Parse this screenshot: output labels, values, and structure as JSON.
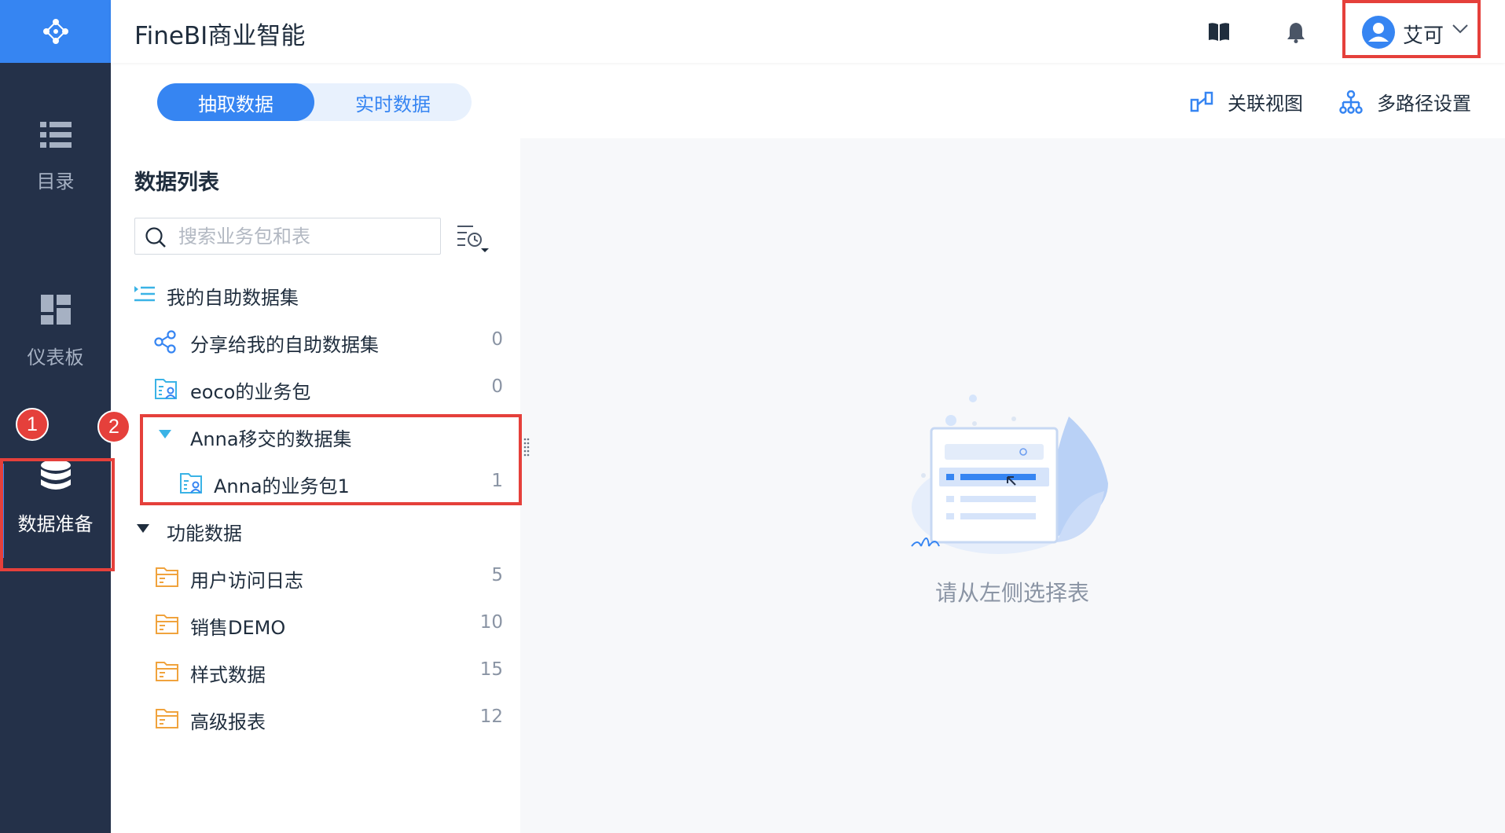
{
  "app": {
    "title": "FineBI商业智能"
  },
  "nav": {
    "items": [
      {
        "label": "目录",
        "icon": "list-icon"
      },
      {
        "label": "仪表板",
        "icon": "dashboard-icon"
      },
      {
        "label": "数据准备",
        "icon": "database-icon",
        "active": true
      }
    ]
  },
  "header": {
    "help_icon": "book-icon",
    "notify_icon": "bell-icon",
    "user": {
      "name": "艾可",
      "icon": "user-avatar-icon"
    }
  },
  "tabs": {
    "extract": "抽取数据",
    "realtime": "实时数据",
    "selected": "抽取数据"
  },
  "toolbar": {
    "relation_view": "关联视图",
    "multipath": "多路径设置"
  },
  "panel": {
    "title": "数据列表",
    "search_placeholder": "搜索业务包和表",
    "tree": {
      "self_service_root": "我的自助数据集",
      "shared": {
        "label": "分享给我的自助数据集",
        "count": "0"
      },
      "eoco": {
        "label": "eoco的业务包",
        "count": "0"
      },
      "anna_group": {
        "label": "Anna移交的数据集"
      },
      "anna_pkg": {
        "label": "Anna的业务包1",
        "count": "1"
      },
      "function_root": "功能数据",
      "folders": [
        {
          "label": "用户访问日志",
          "count": "5"
        },
        {
          "label": "销售DEMO",
          "count": "10"
        },
        {
          "label": "样式数据",
          "count": "15"
        },
        {
          "label": "高级报表",
          "count": "12"
        }
      ]
    }
  },
  "content": {
    "empty_text": "请从左侧选择表"
  },
  "annotations": {
    "badge1": "1",
    "badge2": "2"
  },
  "colors": {
    "accent": "#3685f2",
    "nav_bg": "#243149",
    "highlight": "#e5403b",
    "folder": "#f0a33d"
  }
}
